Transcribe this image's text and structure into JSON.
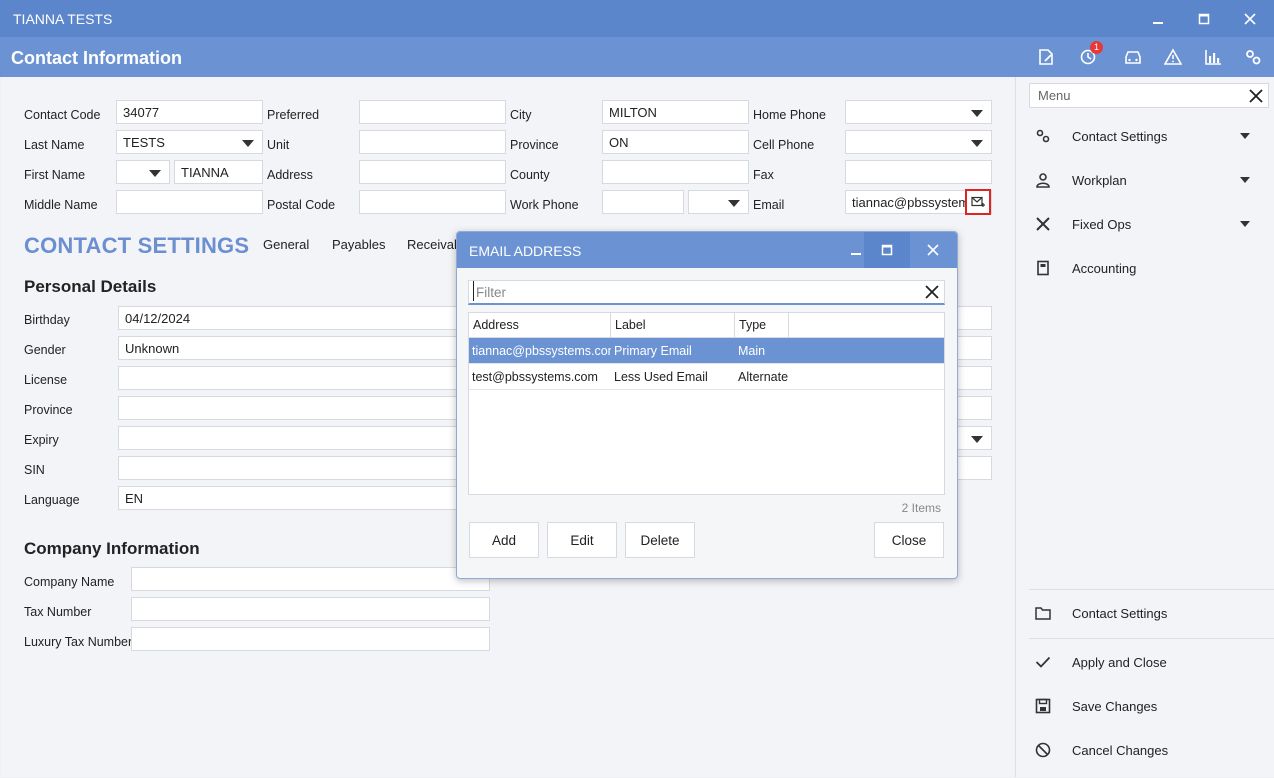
{
  "window": {
    "title": "TIANNA TESTS"
  },
  "header": {
    "title": "Contact Information",
    "notification_count": "1"
  },
  "contact": {
    "contact_code_label": "Contact Code",
    "contact_code": "34077",
    "last_name_label": "Last Name",
    "last_name": "TESTS",
    "first_name_label": "First Name",
    "first_name": "TIANNA",
    "middle_name_label": "Middle Name",
    "middle_name": "",
    "preferred_label": "Preferred",
    "preferred": "",
    "unit_label": "Unit",
    "unit": "",
    "address_label": "Address",
    "address": "",
    "postal_code_label": "Postal Code",
    "postal_code": "",
    "city_label": "City",
    "city": "MILTON",
    "province_label": "Province",
    "province": "ON",
    "county_label": "County",
    "county": "",
    "work_phone_label": "Work Phone",
    "work_phone": "",
    "home_phone_label": "Home Phone",
    "home_phone": "",
    "cell_phone_label": "Cell Phone",
    "cell_phone": "",
    "fax_label": "Fax",
    "fax": "",
    "email_label": "Email",
    "email": "tiannac@pbssystem"
  },
  "settings": {
    "title": "CONTACT SETTINGS",
    "tabs": [
      "General",
      "Payables",
      "Receivab"
    ]
  },
  "personal": {
    "title": "Personal Details",
    "birthday_label": "Birthday",
    "birthday": "04/12/2024",
    "gender_label": "Gender",
    "gender": "Unknown",
    "license_label": "License",
    "license": "",
    "province_label": "Province",
    "province": "",
    "expiry_label": "Expiry",
    "expiry": "",
    "sin_label": "SIN",
    "sin": "",
    "language_label": "Language",
    "language": "EN"
  },
  "company": {
    "title": "Company Information",
    "name_label": "Company Name",
    "name": "",
    "tax_label": "Tax Number",
    "tax": "",
    "luxury_label": "Luxury Tax Number",
    "luxury": ""
  },
  "sidebar": {
    "search_placeholder": "Menu",
    "top_items": [
      {
        "label": "Contact Settings",
        "icon": "gears-icon"
      },
      {
        "label": "Workplan",
        "icon": "person-icon"
      },
      {
        "label": "Fixed Ops",
        "icon": "tools-icon"
      },
      {
        "label": "Accounting",
        "icon": "calculator-icon"
      }
    ],
    "bottom_items": [
      {
        "label": "Contact Settings",
        "icon": "folder-icon"
      },
      {
        "label": "Apply and Close",
        "icon": "check-icon"
      },
      {
        "label": "Save Changes",
        "icon": "save-icon"
      },
      {
        "label": "Cancel Changes",
        "icon": "cancel-icon"
      }
    ]
  },
  "dialog": {
    "title": "EMAIL ADDRESS",
    "filter_placeholder": "Filter",
    "columns": [
      "Address",
      "Label",
      "Type"
    ],
    "rows": [
      {
        "address": "tiannac@pbssystems.com",
        "label": "Primary Email",
        "type": "Main"
      },
      {
        "address": "test@pbssystems.com",
        "label": "Less Used Email",
        "type": "Alternate"
      }
    ],
    "count": "2 Items",
    "buttons": {
      "add": "Add",
      "edit": "Edit",
      "delete": "Delete",
      "close": "Close"
    }
  },
  "colors": {
    "titlebar": "#5b86cc",
    "header": "#6b93d3",
    "accent": "#6b8fd1",
    "highlight": "#e02424"
  }
}
